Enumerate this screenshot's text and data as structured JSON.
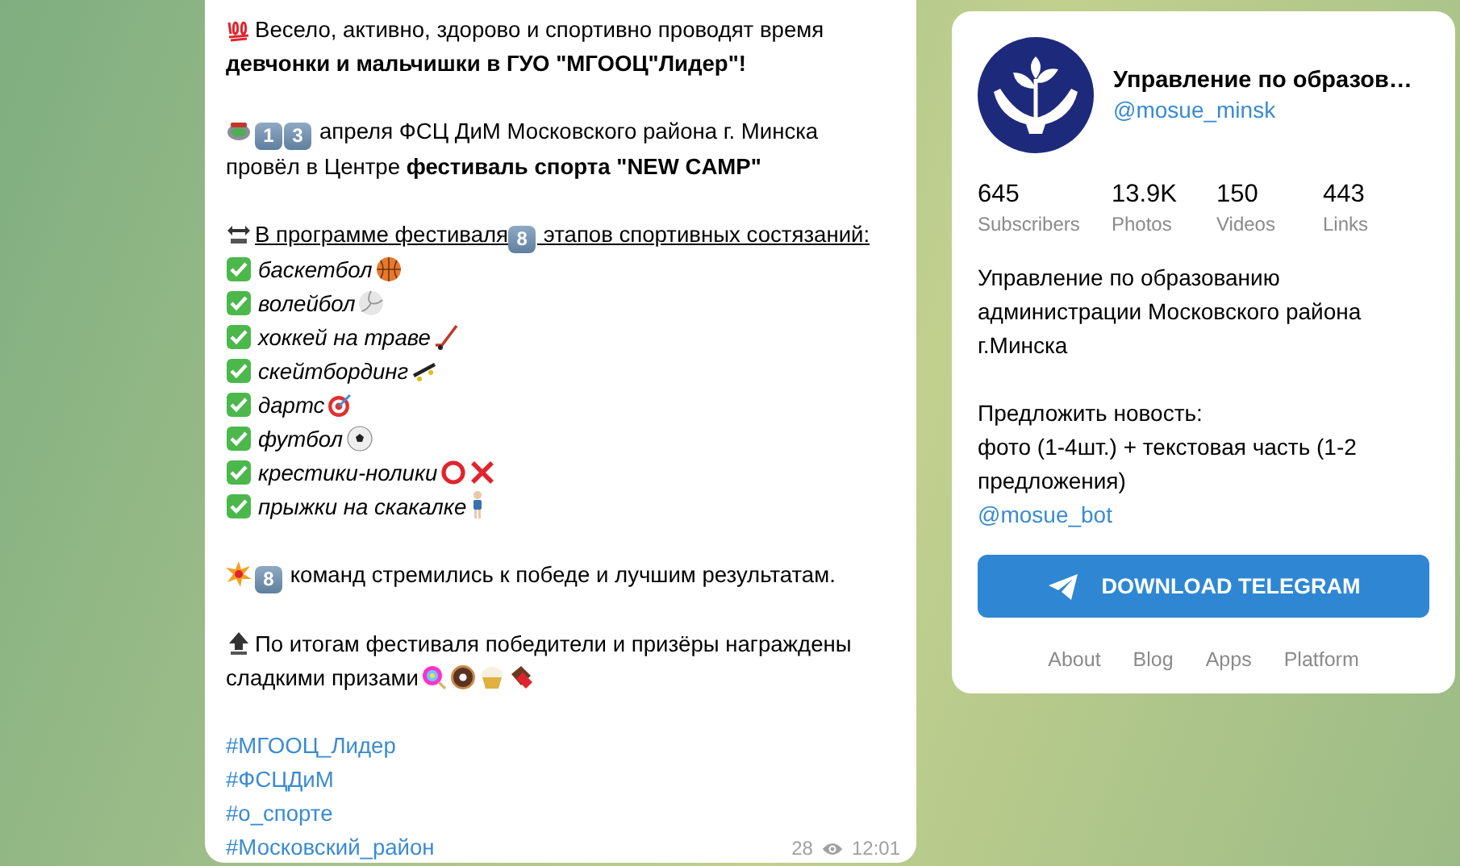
{
  "message": {
    "intro": [
      "Весело, активно, здорово и спортивно проводят время",
      "**девчонки и мальчишки в ГУО \"МГООЦ\"Лидер\"!**"
    ],
    "event": {
      "keycaps": [
        "1",
        "3"
      ],
      "lines": [
        "апреля ФСЦ ДиМ Московского района г. Минска",
        "провёл в Центре **фестиваль спорта \"NEW CAMP\"**"
      ]
    },
    "program_heading": {
      "before": "В программе фестиваля",
      "keycap": "8",
      "after": "этапов спортивных состязаний:"
    },
    "program_items": [
      {
        "text": "баскетбол"
      },
      {
        "text": "волейбол"
      },
      {
        "text": "хоккей на траве"
      },
      {
        "text": "скейтбординг"
      },
      {
        "text": "дартс"
      },
      {
        "text": "футбол"
      },
      {
        "text": "крестики-нолики"
      },
      {
        "text": "прыжки на скакалке"
      }
    ],
    "teams": {
      "keycap": "8",
      "text": "команд стремились к победе и лучшим результатам."
    },
    "results": [
      "По итогам фестиваля победители и призёры награждены",
      "сладкими призами"
    ],
    "hashtags": [
      "#МГООЦ_Лидер",
      "#ФСЦДиМ",
      "#о_спорте",
      "#Московский_район"
    ],
    "views": "28",
    "time": "12:01"
  },
  "channel": {
    "title": "Управление по образов…",
    "handle": "@mosue_minsk",
    "stats": [
      {
        "value": "645",
        "label": "Subscribers"
      },
      {
        "value": "13.9K",
        "label": "Photos"
      },
      {
        "value": "150",
        "label": "Videos"
      },
      {
        "value": "443",
        "label": "Links"
      }
    ],
    "description": "Управление по образованию администрации Московского района г.Минска",
    "suggest_heading": "Предложить новость:",
    "suggest_text": "фото (1-4шт.) + текстовая часть (1-2 предложения)",
    "bot_link": "@mosue_bot",
    "download_button": "DOWNLOAD TELEGRAM",
    "footer_links": [
      "About",
      "Blog",
      "Apps",
      "Platform"
    ]
  }
}
